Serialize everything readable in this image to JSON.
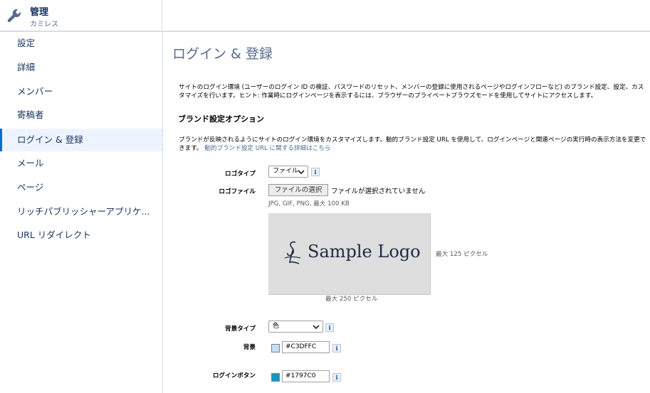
{
  "header": {
    "title": "管理",
    "subtitle": "カミレス",
    "icon": "wrench-icon"
  },
  "sidebar": {
    "items": [
      {
        "label": "設定"
      },
      {
        "label": "詳細"
      },
      {
        "label": "メンバー"
      },
      {
        "label": "寄稿者"
      },
      {
        "label": "ログイン & 登録",
        "active": true
      },
      {
        "label": "メール"
      },
      {
        "label": "ページ"
      },
      {
        "label": "リッチパブリッシャーアプリケ..."
      },
      {
        "label": "URL リダイレクト"
      }
    ]
  },
  "main": {
    "title": "ログイン & 登録",
    "description": "サイトのログイン環境 (ユーザーのログイン ID の検証、パスワードのリセット、メンバーの登録に使用されるページやログインフローなど) のブランド設定、設定、カスタマイズを行います。ヒント: 作業時にログインページを表示するには、ブラウザーのプライベートブラウズモードを使用してサイトにアクセスします。",
    "branding": {
      "title": "ブランド設定オプション",
      "description": "ブランドが反映されるようにサイトのログイン環境をカスタマイズします。動的ブランド設定 URL を使用して、ログインページと関連ページの実行時の表示方法を変更できます。",
      "link": "動的ブランド設定 URL に関する詳細はこちら"
    },
    "logo_type": {
      "label": "ロゴタイプ",
      "value": "ファイル"
    },
    "logo_file": {
      "label": "ロゴファイル",
      "button": "ファイルの選択",
      "status": "ファイルが選択されていません",
      "hint": "JPG, GIF, PNG, 最大 100 KB"
    },
    "logo_preview": {
      "text": "Sample Logo",
      "max_height": "最大 125 ピクセル",
      "max_width": "最大 250 ピクセル"
    },
    "background_type": {
      "label": "背景タイプ",
      "value": "色"
    },
    "background": {
      "label": "背景",
      "value": "#C3DFFC",
      "color": "#C3DFFC"
    },
    "login_button": {
      "label": "ログインボタン",
      "value": "#1797C0",
      "color": "#1797C0"
    },
    "info_icon_text": "i"
  }
}
